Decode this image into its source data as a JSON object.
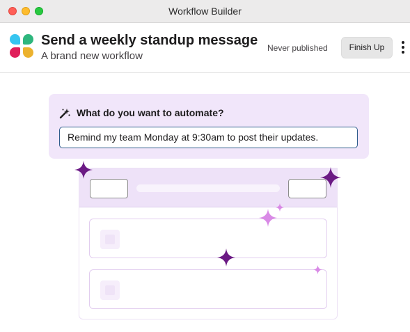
{
  "window": {
    "title": "Workflow Builder"
  },
  "header": {
    "workflow_title": "Send a weekly standup message",
    "workflow_subtitle": "A brand new workflow",
    "publish_status": "Never published",
    "finish_button": "Finish Up"
  },
  "prompt": {
    "question": "What do you want to automate?",
    "input_value": "Remind my team Monday at 9:30am to post their updates."
  },
  "colors": {
    "brand_blue": "#36c5f0",
    "brand_green": "#2eb67d",
    "brand_red": "#e01e5a",
    "brand_yellow": "#ecb22e",
    "prompt_background": "#f1e6fa",
    "sparkle_dark": "#6b1a84",
    "sparkle_light": "#d98ae6"
  },
  "icons": {
    "app_logo": "slack-logo",
    "prompt": "sparkle-wand-icon",
    "more": "vertical-ellipsis-icon",
    "decorations": "sparkle-icon"
  }
}
